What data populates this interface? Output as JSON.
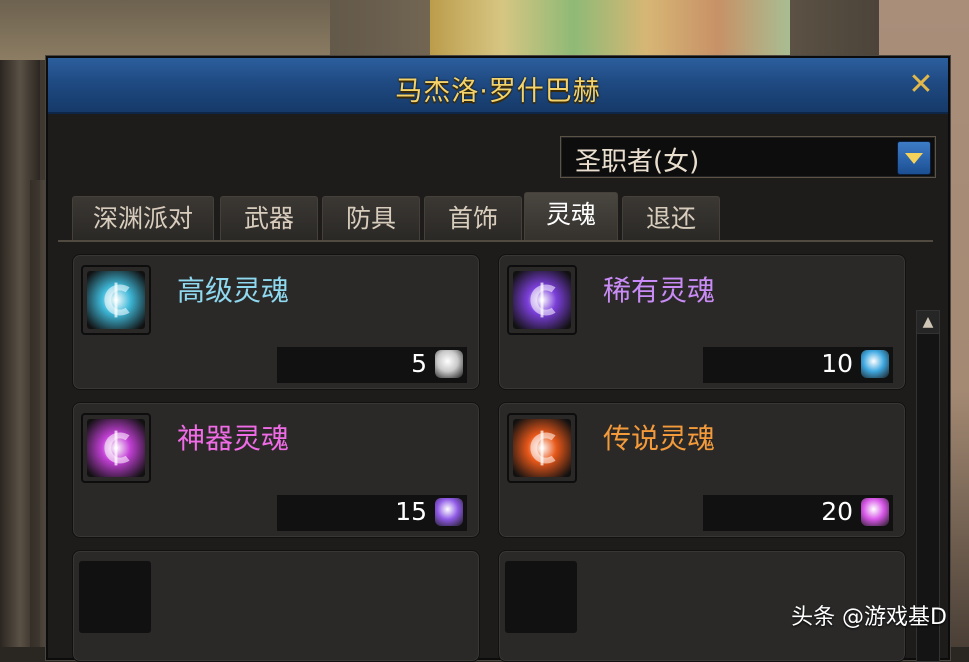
{
  "window": {
    "title": "马杰洛·罗什巴赫",
    "close_glyph": "✕"
  },
  "class_select": {
    "value": "圣职者(女)"
  },
  "tabs": [
    {
      "label": "深渊派对",
      "active": false
    },
    {
      "label": "武器",
      "active": false
    },
    {
      "label": "防具",
      "active": false
    },
    {
      "label": "首饰",
      "active": false
    },
    {
      "label": "灵魂",
      "active": true
    },
    {
      "label": "退还",
      "active": false
    }
  ],
  "items": [
    {
      "name": "高级灵魂",
      "price": "5",
      "name_color": "#8fd9f0",
      "icon": "soul-icon",
      "icon_color": "#3fb8d8",
      "currency_icon": "silver-soul-currency-icon",
      "currency_color": "#c9c9c9"
    },
    {
      "name": "稀有灵魂",
      "price": "10",
      "name_color": "#c98bf5",
      "icon": "soul-icon",
      "icon_color": "#7b3fd9",
      "currency_icon": "blue-soul-currency-icon",
      "currency_color": "#3fa8e0"
    },
    {
      "name": "神器灵魂",
      "price": "15",
      "name_color": "#f06be6",
      "icon": "soul-icon",
      "icon_color": "#c13fd4",
      "currency_icon": "purple-soul-currency-icon",
      "currency_color": "#8f5ae6"
    },
    {
      "name": "传说灵魂",
      "price": "20",
      "name_color": "#f39a3a",
      "icon": "soul-icon",
      "icon_color": "#e8581a",
      "currency_icon": "magenta-soul-currency-icon",
      "currency_color": "#d857e8"
    }
  ],
  "watermark": "头条 @游戏基D"
}
